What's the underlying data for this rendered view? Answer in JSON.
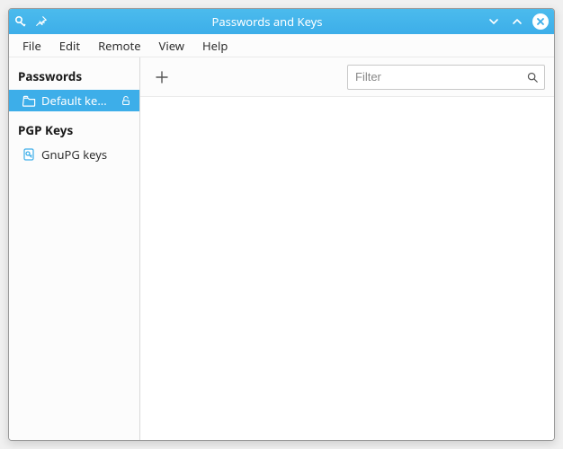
{
  "window": {
    "title": "Passwords and Keys"
  },
  "menubar": {
    "items": [
      {
        "label": "File"
      },
      {
        "label": "Edit"
      },
      {
        "label": "Remote"
      },
      {
        "label": "View"
      },
      {
        "label": "Help"
      }
    ]
  },
  "sidebar": {
    "sections": [
      {
        "header": "Passwords",
        "items": [
          {
            "label": "Default ke...",
            "icon": "folder",
            "trailing": "lock-open",
            "selected": true
          }
        ]
      },
      {
        "header": "PGP Keys",
        "items": [
          {
            "label": "GnuPG keys",
            "icon": "key-doc",
            "selected": false
          }
        ]
      }
    ]
  },
  "toolbar": {
    "filter_placeholder": "Filter",
    "filter_value": ""
  }
}
